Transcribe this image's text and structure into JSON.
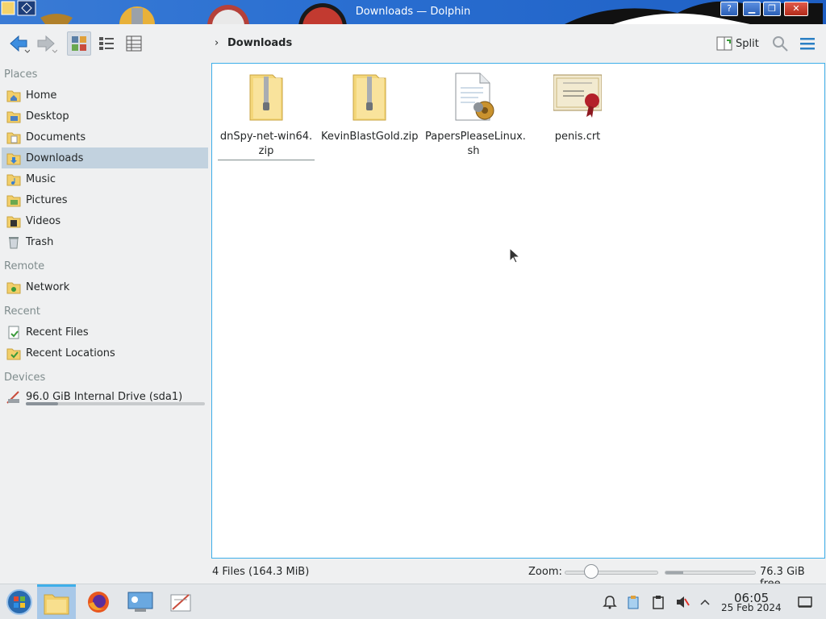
{
  "window": {
    "title": "Downloads — Dolphin",
    "buttons": {
      "help": "?",
      "minimize": "▁",
      "maximize": "❐",
      "close": "✕"
    }
  },
  "toolbar": {
    "breadcrumb_sep": "›",
    "breadcrumb": "Downloads",
    "split_label": "Split"
  },
  "sidebar": {
    "sections": {
      "places": "Places",
      "remote": "Remote",
      "recent": "Recent",
      "devices": "Devices"
    },
    "places": [
      {
        "label": "Home",
        "icon": "home-folder-icon"
      },
      {
        "label": "Desktop",
        "icon": "desktop-folder-icon"
      },
      {
        "label": "Documents",
        "icon": "documents-folder-icon"
      },
      {
        "label": "Downloads",
        "icon": "downloads-folder-icon",
        "selected": true
      },
      {
        "label": "Music",
        "icon": "music-folder-icon"
      },
      {
        "label": "Pictures",
        "icon": "pictures-folder-icon"
      },
      {
        "label": "Videos",
        "icon": "videos-folder-icon"
      },
      {
        "label": "Trash",
        "icon": "trash-icon"
      }
    ],
    "remote": [
      {
        "label": "Network",
        "icon": "network-folder-icon"
      }
    ],
    "recent": [
      {
        "label": "Recent Files",
        "icon": "recent-files-icon"
      },
      {
        "label": "Recent Locations",
        "icon": "recent-locations-icon"
      }
    ],
    "devices": [
      {
        "label": "96.0 GiB Internal Drive (sda1)",
        "icon": "drive-icon",
        "usage_fraction": 0.18
      }
    ]
  },
  "files": [
    {
      "name_line1": "dnSpy-net-win64.",
      "name_line2": "zip",
      "icon": "zip-folder-icon"
    },
    {
      "name_line1": "KevinBlastGold.zip",
      "name_line2": "",
      "icon": "zip-folder-icon"
    },
    {
      "name_line1": "PapersPleaseLinux.",
      "name_line2": "sh",
      "icon": "script-file-icon"
    },
    {
      "name_line1": "penis.crt",
      "name_line2": "",
      "icon": "certificate-icon"
    }
  ],
  "statusbar": {
    "summary": "4 Files (164.3 MiB)",
    "zoom_label": "Zoom:",
    "free_space": "76.3 GiB free",
    "disk_used_fraction": 0.2
  },
  "taskbar": {
    "time": "06:05",
    "date": "25 Feb 2024"
  },
  "colors": {
    "accent": "#3daee9",
    "selection": "#c2d2df",
    "titlebar": "#2a6fd1"
  }
}
